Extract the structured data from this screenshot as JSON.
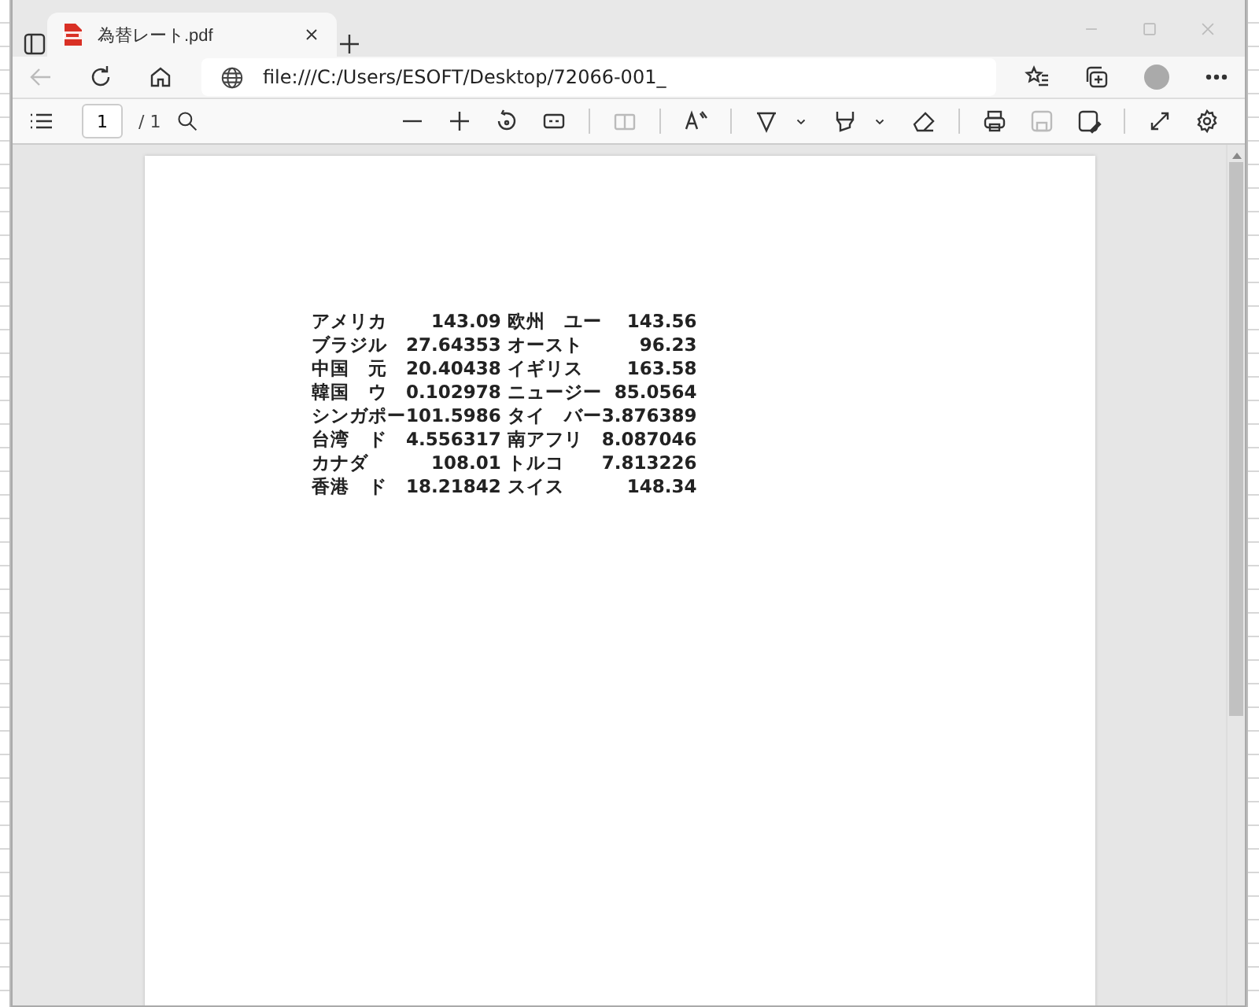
{
  "tab": {
    "title": "為替レート.pdf",
    "selected": true
  },
  "address_bar": {
    "url": "file:///C:/Users/ESOFT/Desktop/72066-001_"
  },
  "pdf_toolbar": {
    "page_number": "1",
    "page_count": "/ 1",
    "tools": [
      {
        "disabled": false
      },
      {
        "disabled": false
      },
      {
        "disabled": false
      },
      {
        "disabled": false
      },
      {
        "disabled": true
      },
      {
        "disabled": false
      },
      {
        "disabled": false
      },
      {
        "disabled": false
      },
      {
        "disabled": false
      },
      {
        "disabled": false
      },
      {
        "disabled": false
      },
      {
        "disabled": false
      },
      {
        "disabled": true
      },
      {
        "disabled": false
      },
      {
        "disabled": false
      },
      {
        "disabled": false
      }
    ]
  },
  "document": {
    "rows": [
      {
        "cells": [
          "アメリカ",
          "143.09",
          "欧州　ユー",
          "143.56"
        ]
      },
      {
        "cells": [
          "ブラジル",
          "27.64353",
          "オースト",
          "96.23"
        ]
      },
      {
        "cells": [
          "中国　元",
          "20.40438",
          "イギリス",
          "163.58"
        ]
      },
      {
        "cells": [
          "韓国　ウ",
          "0.102978",
          "ニュージー",
          "85.0564"
        ]
      },
      {
        "cells": [
          "シンガポー",
          "101.5986",
          "タイ　バー",
          "3.876389"
        ]
      },
      {
        "cells": [
          "台湾　ド",
          "4.556317",
          "南アフリ",
          "8.087046"
        ]
      },
      {
        "cells": [
          "カナダ",
          "108.01",
          "トルコ",
          "7.813226"
        ]
      },
      {
        "cells": [
          "香港　ド",
          "18.21842",
          "スイス",
          "148.34"
        ]
      }
    ]
  }
}
